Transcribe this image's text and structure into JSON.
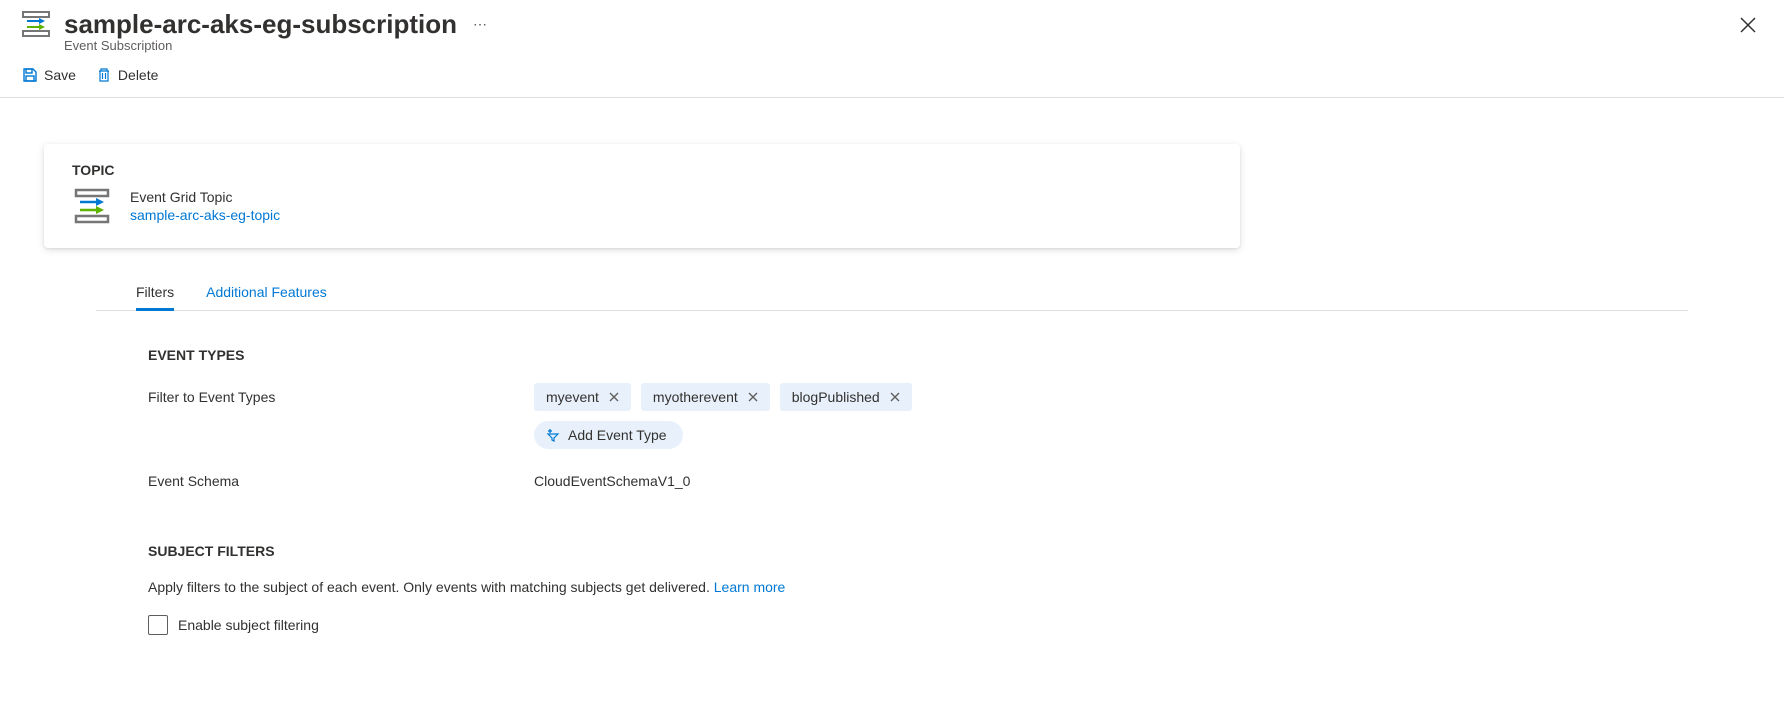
{
  "header": {
    "title": "sample-arc-aks-eg-subscription",
    "subtitle": "Event Subscription"
  },
  "toolbar": {
    "save_label": "Save",
    "delete_label": "Delete"
  },
  "topic": {
    "heading": "TOPIC",
    "type_label": "Event Grid Topic",
    "link_text": "sample-arc-aks-eg-topic"
  },
  "tabs": {
    "filters": "Filters",
    "additional": "Additional Features"
  },
  "event_types": {
    "heading": "EVENT TYPES",
    "filter_label": "Filter to Event Types",
    "chips": [
      "myevent",
      "myotherevent",
      "blogPublished"
    ],
    "add_label": "Add Event Type",
    "schema_label": "Event Schema",
    "schema_value": "CloudEventSchemaV1_0"
  },
  "subject_filters": {
    "heading": "SUBJECT FILTERS",
    "description": "Apply filters to the subject of each event. Only events with matching subjects get delivered.",
    "learn_more": "Learn more",
    "checkbox_label": "Enable subject filtering"
  }
}
